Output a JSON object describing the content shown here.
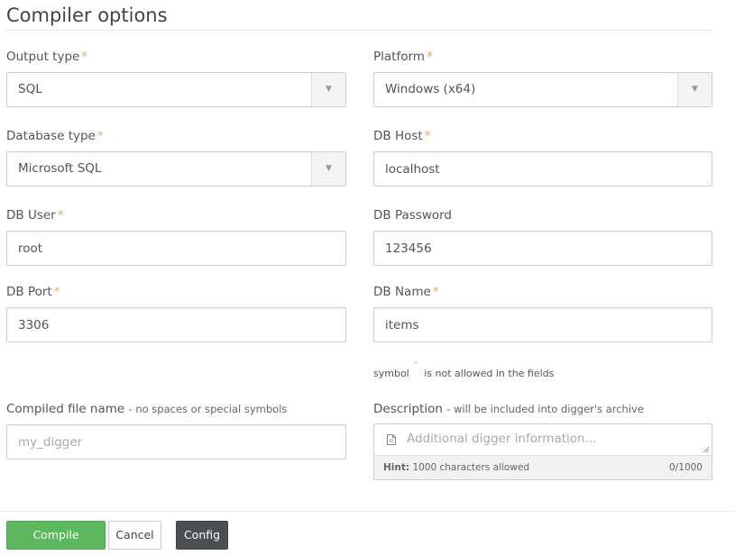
{
  "title": "Compiler options",
  "required_mark": "*",
  "output_type": {
    "label": "Output type",
    "value": "SQL"
  },
  "platform": {
    "label": "Platform",
    "value": "Windows (x64)"
  },
  "database_type": {
    "label": "Database type",
    "value": "Microsoft SQL"
  },
  "db_host": {
    "label": "DB Host",
    "value": "localhost"
  },
  "db_user": {
    "label": "DB User",
    "value": "root"
  },
  "db_password": {
    "label": "DB Password",
    "value": "123456"
  },
  "db_port": {
    "label": "DB Port",
    "value": "3306"
  },
  "db_name": {
    "label": "DB Name",
    "value": "items"
  },
  "symbol_note": {
    "before": "symbol",
    "symbol": "`",
    "after": "is not allowed in the fields"
  },
  "compiled_file": {
    "label": "Compiled file name",
    "sublabel": "- no spaces or special symbols",
    "placeholder": "my_digger"
  },
  "description": {
    "label": "Description",
    "sublabel": "- will be included into digger's archive",
    "placeholder": "Additional digger information...",
    "hint_label": "Hint:",
    "hint_text": "1000 characters allowed",
    "counter": "0/1000"
  },
  "buttons": {
    "compile": "Compile",
    "cancel": "Cancel",
    "config": "Config"
  },
  "icons": {
    "dropdown": "caret-down-icon",
    "description": "document-icon"
  },
  "colors": {
    "required": "#f0a35a",
    "compile": "#5cb85c",
    "config": "#4a4f52"
  }
}
